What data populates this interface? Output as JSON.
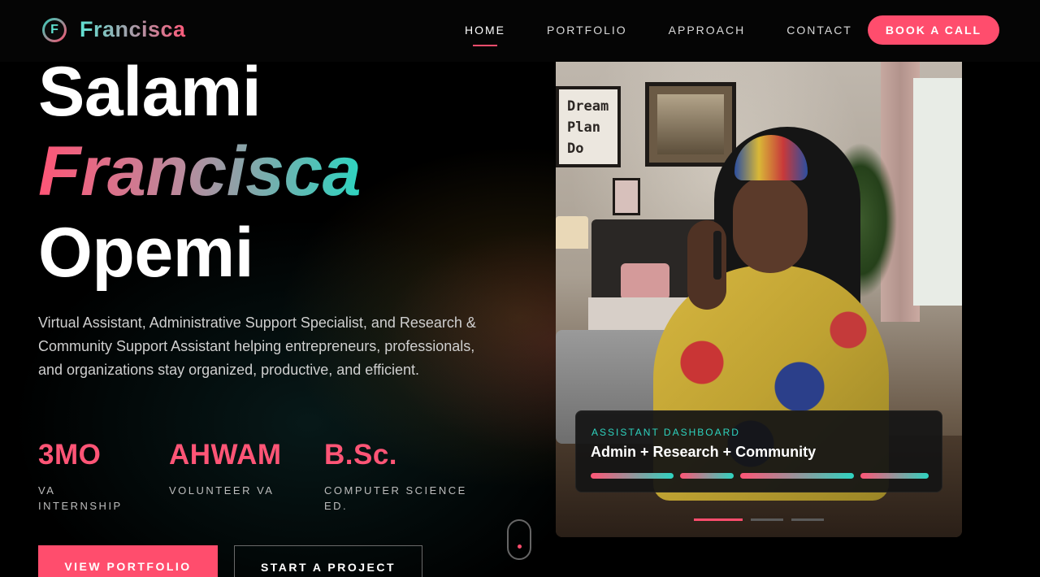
{
  "header": {
    "logo_letter": "F",
    "logo_text": "Francisca",
    "nav": [
      "HOME",
      "PORTFOLIO",
      "APPROACH",
      "CONTACT"
    ],
    "active_nav": "HOME",
    "book_call": "BOOK A CALL"
  },
  "hero": {
    "name_line_1": "Salami",
    "name_line_2": "Francisca",
    "name_line_3": "Opemi",
    "intro": "Virtual Assistant, Administrative Support Specialist, and Research & Community Support Assistant helping entrepreneurs, professionals, and organizations stay organized, productive, and efficient.",
    "stats": [
      {
        "value": "3MO",
        "label": "VA INTERNSHIP"
      },
      {
        "value": "AHWAM",
        "label": "VOLUNTEER VA"
      },
      {
        "value": "B.Sc.",
        "label": "COMPUTER SCIENCE ED."
      }
    ],
    "primary_button": "VIEW PORTFOLIO",
    "secondary_button": "START A PROJECT"
  },
  "photo": {
    "frame_words": [
      "Dream",
      "Plan",
      "Do"
    ],
    "dashboard_label": "ASSISTANT DASHBOARD",
    "dashboard_title": "Admin + Research + Community",
    "slides_count": 3,
    "active_slide": 1
  },
  "colors": {
    "accent": "#ff4d6d",
    "teal": "#2ed4c0",
    "background": "#000000"
  }
}
